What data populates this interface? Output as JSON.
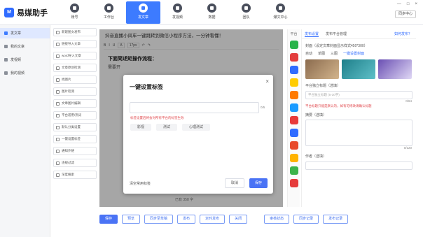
{
  "app": {
    "name": "易媒助手",
    "logo_letter": "M"
  },
  "window": {
    "controls": [
      "—",
      "□",
      "×"
    ],
    "sync_label": "同步中心"
  },
  "nav": [
    {
      "label": "账号",
      "icon": "user-icon"
    },
    {
      "label": "工作台",
      "icon": "workbench-icon"
    },
    {
      "label": "发文章",
      "icon": "compose-icon",
      "active": true
    },
    {
      "label": "发视频",
      "icon": "video-icon"
    },
    {
      "label": "数据",
      "icon": "data-icon"
    },
    {
      "label": "团队",
      "icon": "team-icon"
    },
    {
      "label": "爆文中心",
      "icon": "hot-icon"
    }
  ],
  "sidebar": [
    {
      "label": "发文章",
      "active": true
    },
    {
      "label": "我的文章"
    },
    {
      "label": "发视频"
    },
    {
      "label": "我的视频"
    }
  ],
  "tools": [
    "新建图文发布",
    "链接导入文章",
    "word导入文章",
    "文章原创检测",
    "找图片",
    "图片检测",
    "文章图片编辑",
    "平台适用/热词",
    "默认分类设置",
    "一键设置标签",
    "通知外链",
    "违规过滤",
    "深度搜索"
  ],
  "editor": {
    "title_line": "抖音直播小风车一键跳转到微信小程序方法，一分钟看懂！",
    "toolbar_font": "A",
    "toolbar_size": "17px",
    "heading": "下面简述矩操作流程：",
    "body_text": "需要开",
    "word_count": "已有 358 字"
  },
  "modal": {
    "title": "一键设置标签",
    "close": "×",
    "input_count": "0/5",
    "hint": "标签设置后将会对所有平台的标签生效",
    "chips": [
      "影视",
      "测试",
      "心理测试"
    ],
    "clear_label": "清空常用标签",
    "cancel_label": "取消",
    "save_label": "保存"
  },
  "platforms": {
    "label": "平台",
    "colors": [
      "#29b34a",
      "#e23b3b",
      "#2f6bff",
      "#ffcc00",
      "#ff7a00",
      "#1a9aff",
      "#e83a3a",
      "#2f6bff",
      "#e84a2a",
      "#ffb300",
      "#3cb34a",
      "#e63c3c"
    ]
  },
  "right_panel": {
    "tabs": [
      "发布设置",
      "发布平台管理"
    ],
    "help": "如何发布？",
    "cover_label": "封面（设定文章封面显示样式450*300）",
    "radio": [
      "自动",
      "单图",
      "三图",
      "一键设置封面"
    ],
    "summary_label": "平台独立标题（选填）",
    "summary_placeholder": "平台独立标题 (5-30字)",
    "summary_count": "0/64",
    "summary_hint": "平台标题只能是默认的，如有可修改请确认标题",
    "abstract_label": "摘要（选填）",
    "abstract_count": "0/120",
    "author_label": "作者（选填）"
  },
  "bottom": {
    "buttons": [
      "保存",
      "预览",
      "同步至草稿",
      "发布",
      "定时发布",
      "关闭"
    ],
    "right_buttons": [
      "审核状态",
      "同步记录",
      "发布记录"
    ]
  }
}
